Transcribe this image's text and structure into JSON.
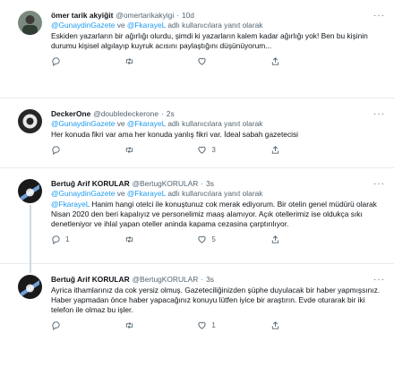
{
  "tweets": [
    {
      "name": "ömer tarik akyiğit",
      "handle": "@omertarikakyigi",
      "dot": "·",
      "time": "10d",
      "more": "···",
      "reply_mention_1": "@GunaydinGazete",
      "reply_connector": "ve",
      "reply_mention_2": "@FkarayeL",
      "reply_suffix": "adlı kullanıcılara yanıt olarak",
      "text": "Eskiden yazarların bir ağırlığı olurdu, şimdi ki yazarların kalem kadar ağırlığı yok! Ben bu kişinin durumu kişisel algılayıp kuyruk acısını paylaştığını düşünüyorum...",
      "replies": "",
      "retweets": "",
      "likes": ""
    },
    {
      "name": "DeckerOne",
      "handle": "@doubledeckerone",
      "dot": "·",
      "time": "2s",
      "more": "···",
      "reply_mention_1": "@GunaydinGazete",
      "reply_connector": "ve",
      "reply_mention_2": "@FkarayeL",
      "reply_suffix": "adlı kullanıcılara yanıt olarak",
      "text": "Her konuda fikri var ama her konuda yanlış fikri var. İdeal sabah gazetecisi",
      "replies": "",
      "retweets": "",
      "likes": "3"
    },
    {
      "name": "Bertuğ Arif KORULAR",
      "handle": "@BertugKORULAR",
      "dot": "·",
      "time": "3s",
      "more": "···",
      "reply_mention_1": "@GunaydinGazete",
      "reply_connector": "ve",
      "reply_mention_2": "@FkarayeL",
      "reply_suffix": "adlı kullanıcılara yanıt olarak",
      "text_mention": "@FkarayeL",
      "text": " Hanim hangi otelci ile konuştunuz cok merak ediyorum. Bir otelin genel müdürü olarak Nisan 2020 den beri kapalıyız ve personelimiz maaş alamıyor. Açık otellerimiz ise oldukça sıkı denetleniyor ve ihlal yapan oteller aninda kapama cezasina çarptırılıyor.",
      "replies": "1",
      "retweets": "",
      "likes": "5"
    },
    {
      "name": "Bertuğ Arif KORULAR",
      "handle": "@BertugKORULAR",
      "dot": "·",
      "time": "3s",
      "more": "···",
      "text": "Ayrica ithamlarınız da cok yersiz olmuş. Gazeteciliğinizden şüphe duyulacak bir haber yapmışsınız. Haber yapmadan önce haber yapacağınız konuyu lütfen iyice bir araştırın. Evde oturarak bir iki telefon ile olmaz bu işler.",
      "replies": "",
      "retweets": "",
      "likes": "1"
    }
  ]
}
